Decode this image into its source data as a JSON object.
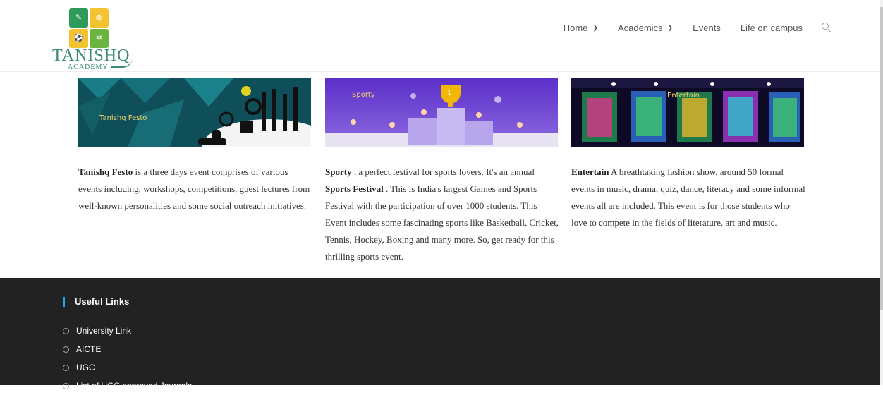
{
  "brand": {
    "name": "TANISHQ",
    "subtitle": "ACADEMY"
  },
  "nav": {
    "items": [
      {
        "label": "Home",
        "dropdown": true
      },
      {
        "label": "Academics",
        "dropdown": true
      },
      {
        "label": "Events",
        "dropdown": false
      },
      {
        "label": "Life on campus",
        "dropdown": false
      }
    ],
    "search_icon": "search-icon"
  },
  "cards": [
    {
      "image_label": "Tanishq Festo",
      "bold": "Tanishq Festo",
      "text": " is a three days event comprises of various events including, workshops, competitions, guest lectures from well-known personalities and some social outreach initiatives."
    },
    {
      "image_label": "Sporty",
      "bold": "Sporty",
      "text_a": " , a perfect festival for sports lovers. It's an annual ",
      "bold_b": "Sports Festival",
      "text_b": " . This is India's largest Games and Sports Festival with the participation of over 1000 students. This Event includes some fascinating sports like Basketball, Cricket, Tennis, Hockey, Boxing and many more. So, get ready for this thrilling sports event."
    },
    {
      "image_label": "Entertain",
      "bold": "Entertain",
      "text": " A breathtaking fashion show, around 50 formal events in music, drama, quiz, dance, literacy and some informal events all are included. This event is for those students who love to compete in the fields of literature, art and music."
    }
  ],
  "footer": {
    "title": "Useful Links",
    "links": [
      "University Link",
      "AICTE",
      "UGC",
      "List of UGC approved Journals"
    ]
  },
  "colors": {
    "accent": "#13aff0",
    "footer_bg": "#222222",
    "logo_green": "#3a8c6e"
  }
}
